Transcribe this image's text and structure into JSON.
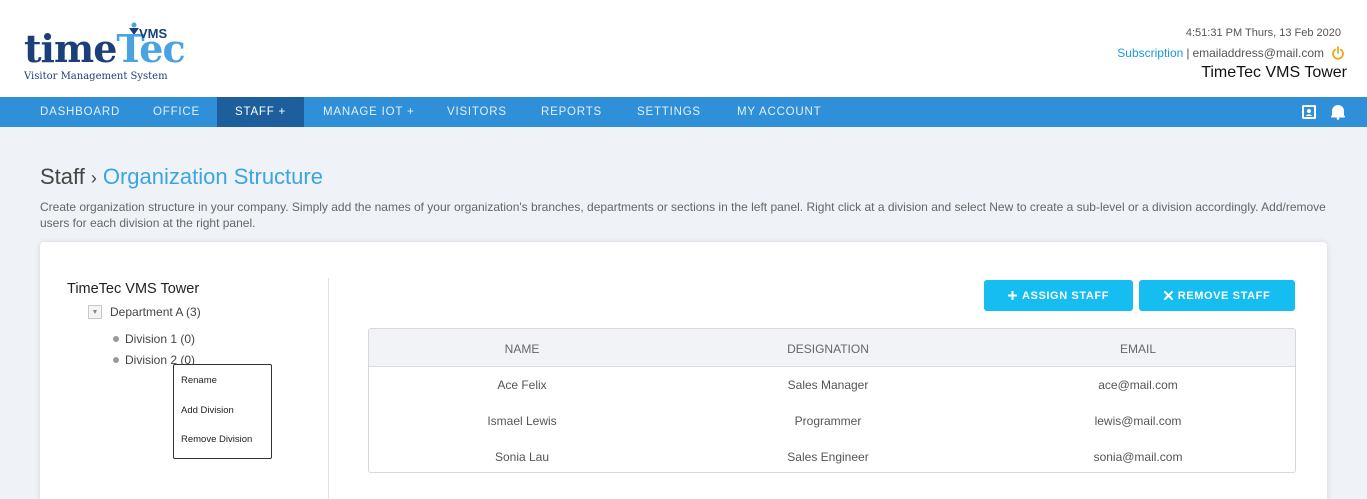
{
  "header": {
    "logo": {
      "time": "time",
      "tec": "Tec",
      "vms": "VMS",
      "subtitle": "Visitor Management System"
    },
    "datetime": "4:51:31 PM Thurs, 13 Feb 2020",
    "subscription_link": "Subscription",
    "separator": "|",
    "email": "emailaddress@mail.com",
    "power_icon": "power-icon",
    "tower": "TimeTec VMS Tower"
  },
  "nav": {
    "items": [
      {
        "label": "DASHBOARD"
      },
      {
        "label": "OFFICE"
      },
      {
        "label": "STAFF +"
      },
      {
        "label": "MANAGE IOT +"
      },
      {
        "label": "VISITORS"
      },
      {
        "label": "REPORTS"
      },
      {
        "label": "SETTINGS"
      },
      {
        "label": "MY ACCOUNT"
      }
    ],
    "active": "STAFF +",
    "icons": [
      "contact-card-icon",
      "notification-bell-icon"
    ]
  },
  "page": {
    "breadcrumb_parent": "Staff",
    "breadcrumb_sep": "›",
    "breadcrumb_current": "Organization Structure",
    "description": "Create organization structure in your company. Simply add the names of your organization's branches, departments or sections in the left panel. Right click at a division and select New to create a sub-level or a division accordingly. Add/remove users for each division at the right panel."
  },
  "tree": {
    "root": "TimeTec VMS Tower",
    "department": "Department A (3)",
    "divisions": [
      "Division 1 (0)",
      "Division 2 (0)"
    ]
  },
  "context_menu": {
    "items": [
      "Rename",
      "Add Division",
      "Remove Division"
    ]
  },
  "actions": {
    "assign": "ASSIGN STAFF",
    "remove": "REMOVE STAFF"
  },
  "table": {
    "headers": [
      "NAME",
      "DESIGNATION",
      "EMAIL"
    ],
    "rows": [
      {
        "name": "Ace Felix",
        "designation": "Sales Manager",
        "email": "ace@mail.com"
      },
      {
        "name": "Ismael Lewis",
        "designation": "Programmer",
        "email": "lewis@mail.com"
      },
      {
        "name": "Sonia Lau",
        "designation": "Sales Engineer",
        "email": "sonia@mail.com"
      }
    ]
  },
  "colors": {
    "nav_bg": "#2f8fd8",
    "nav_active": "#1d5f9c",
    "accent": "#3aa6e0",
    "button": "#16bdf0",
    "logo_dark": "#1b3f78",
    "power": "#f2a20f"
  }
}
